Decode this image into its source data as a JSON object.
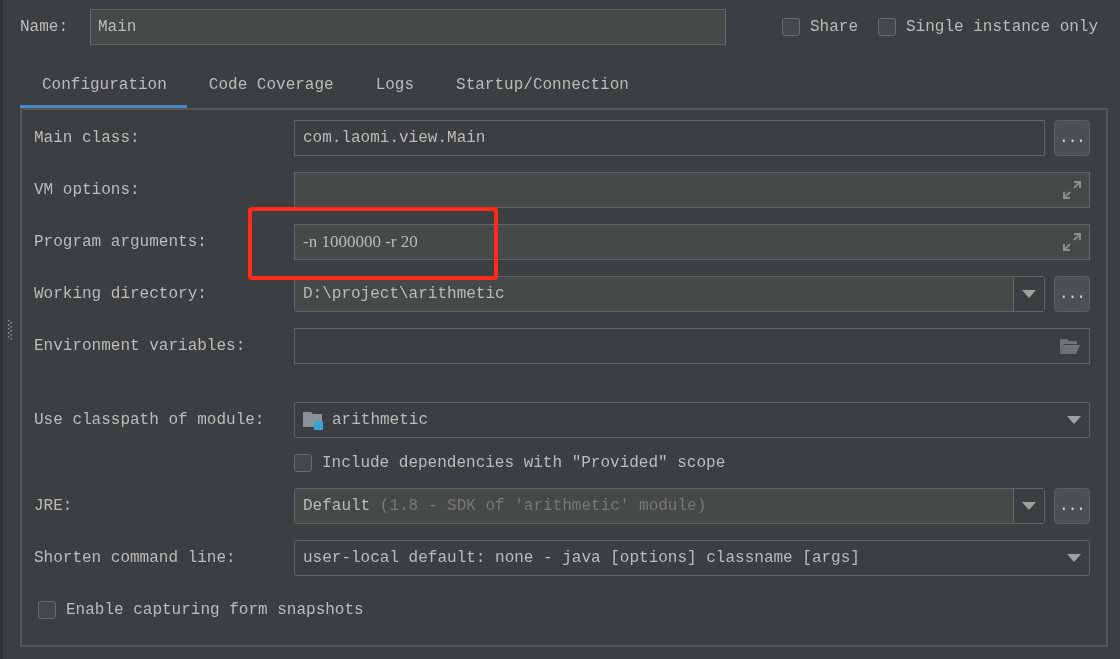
{
  "name_field": {
    "label": "Name:",
    "value": "Main"
  },
  "options": [
    {
      "label": "Share",
      "checked": false
    },
    {
      "label": "Single instance only",
      "checked": false
    }
  ],
  "tabs": [
    {
      "label": "Configuration",
      "selected": true
    },
    {
      "label": "Code Coverage",
      "selected": false
    },
    {
      "label": "Logs",
      "selected": false
    },
    {
      "label": "Startup/Connection",
      "selected": false
    }
  ],
  "rows": [
    {
      "kind": "browse",
      "label": "Main class:",
      "value": "com.laomi.view.Main",
      "button": "..."
    },
    {
      "kind": "expand",
      "label": "VM options:",
      "highlighted": false
    },
    {
      "kind": "expand",
      "label": "Program arguments:",
      "value": "-n 1000000 -r 20",
      "highlighted": true
    },
    {
      "kind": "combo-browse",
      "label": "Working directory:",
      "value": "D:\\project\\arithmetic",
      "button": "..."
    },
    {
      "kind": "folder",
      "label": "Environment variables:"
    },
    {
      "kind": "module",
      "label": "Use classpath of module:",
      "value": "arithmetic"
    },
    {
      "kind": "check",
      "label": "Include dependencies with \"Provided\" scope",
      "checked": false
    },
    {
      "kind": "jre",
      "label": "JRE:",
      "value": "Default",
      "hint": "(1.8 - SDK of 'arithmetic' module)",
      "button": "..."
    },
    {
      "kind": "combo",
      "label": "Shorten command line:",
      "value": "user-local default: none - java [options] classname [args]"
    },
    {
      "kind": "wide-check",
      "label": "Enable capturing form snapshots",
      "checked": false
    }
  ]
}
